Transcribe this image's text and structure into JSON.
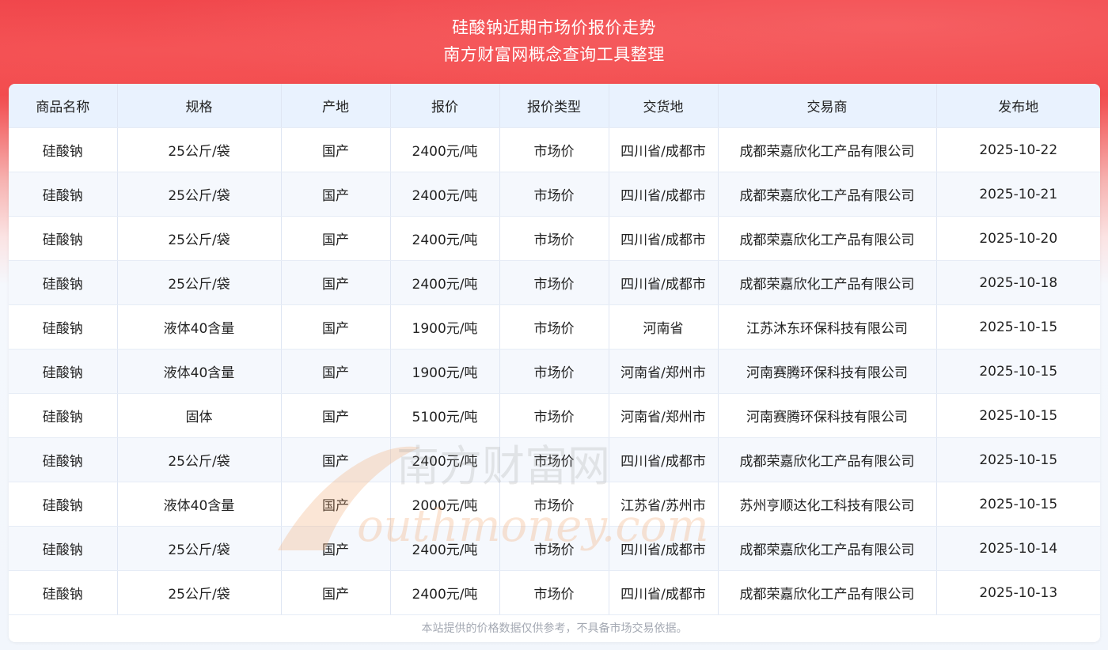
{
  "header": {
    "title": "硅酸钠近期市场价报价走势",
    "subtitle": "南方财富网概念查询工具整理"
  },
  "table": {
    "columns": [
      "商品名称",
      "规格",
      "产地",
      "报价",
      "报价类型",
      "交货地",
      "交易商",
      "发布地"
    ],
    "rows": [
      [
        "硅酸钠",
        "25公斤/袋",
        "国产",
        "2400元/吨",
        "市场价",
        "四川省/成都市",
        "成都荣嘉欣化工产品有限公司",
        "2025-10-22"
      ],
      [
        "硅酸钠",
        "25公斤/袋",
        "国产",
        "2400元/吨",
        "市场价",
        "四川省/成都市",
        "成都荣嘉欣化工产品有限公司",
        "2025-10-21"
      ],
      [
        "硅酸钠",
        "25公斤/袋",
        "国产",
        "2400元/吨",
        "市场价",
        "四川省/成都市",
        "成都荣嘉欣化工产品有限公司",
        "2025-10-20"
      ],
      [
        "硅酸钠",
        "25公斤/袋",
        "国产",
        "2400元/吨",
        "市场价",
        "四川省/成都市",
        "成都荣嘉欣化工产品有限公司",
        "2025-10-18"
      ],
      [
        "硅酸钠",
        "液体40含量",
        "国产",
        "1900元/吨",
        "市场价",
        "河南省",
        "江苏沐东环保科技有限公司",
        "2025-10-15"
      ],
      [
        "硅酸钠",
        "液体40含量",
        "国产",
        "1900元/吨",
        "市场价",
        "河南省/郑州市",
        "河南赛腾环保科技有限公司",
        "2025-10-15"
      ],
      [
        "硅酸钠",
        "固体",
        "国产",
        "5100元/吨",
        "市场价",
        "河南省/郑州市",
        "河南赛腾环保科技有限公司",
        "2025-10-15"
      ],
      [
        "硅酸钠",
        "25公斤/袋",
        "国产",
        "2400元/吨",
        "市场价",
        "四川省/成都市",
        "成都荣嘉欣化工产品有限公司",
        "2025-10-15"
      ],
      [
        "硅酸钠",
        "液体40含量",
        "国产",
        "2000元/吨",
        "市场价",
        "江苏省/苏州市",
        "苏州亨顺达化工科技有限公司",
        "2025-10-15"
      ],
      [
        "硅酸钠",
        "25公斤/袋",
        "国产",
        "2400元/吨",
        "市场价",
        "四川省/成都市",
        "成都荣嘉欣化工产品有限公司",
        "2025-10-14"
      ],
      [
        "硅酸钠",
        "25公斤/袋",
        "国产",
        "2400元/吨",
        "市场价",
        "四川省/成都市",
        "成都荣嘉欣化工产品有限公司",
        "2025-10-13"
      ]
    ]
  },
  "footnote": "本站提供的价格数据仅供参考，不具备市场交易依据。",
  "watermark": {
    "cn": "南方财富网",
    "en": "outhmoney.com"
  },
  "colors": {
    "header_red": "#f0454a",
    "table_header_bg": "#e9f2fe",
    "stripe_bg": "#f5f8fd",
    "watermark_orange": "#f2a66a"
  }
}
